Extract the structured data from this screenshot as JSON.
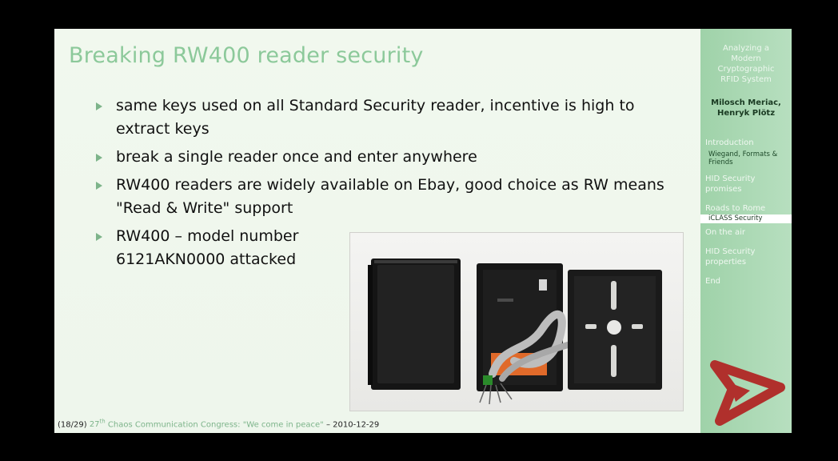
{
  "slide": {
    "title": "Breaking RW400 reader security",
    "bullets": [
      "same keys used on all Standard Security reader, incentive is high to extract keys",
      "break a single reader once and enter anywhere",
      "RW400 readers are widely available on Ebay, good choice as RW means \"Read & Write\" support",
      "RW400 – model number 6121AKN0000 attacked"
    ]
  },
  "footer": {
    "page": "(18/29)",
    "congress_num": "27",
    "congress_sup": "th",
    "congress_name": "Chaos Communication Congress:",
    "motto": "\"We come in peace\"",
    "date": "– 2010-12-29"
  },
  "sidebar": {
    "title_lines": [
      "Analyzing a",
      "Modern",
      "Cryptographic",
      "RFID System"
    ],
    "author_lines": [
      "Milosch Meriac,",
      "Henryk Plötz"
    ],
    "toc": {
      "introduction": "Introduction",
      "wiegand_1": "Wiegand, Formats &",
      "wiegand_2": "Friends",
      "hid_promises_1": "HID Security",
      "hid_promises_2": "promises",
      "roads": "Roads to Rome",
      "iclass": "iCLASS Security",
      "on_air": "On the air",
      "hid_props_1": "HID Security",
      "hid_props_2": "properties",
      "end": "End"
    }
  },
  "colors": {
    "accent": "#8cc99a",
    "bullet": "#7db48a",
    "sidebar": "#a8d8b0",
    "logo": "#b0302c"
  }
}
